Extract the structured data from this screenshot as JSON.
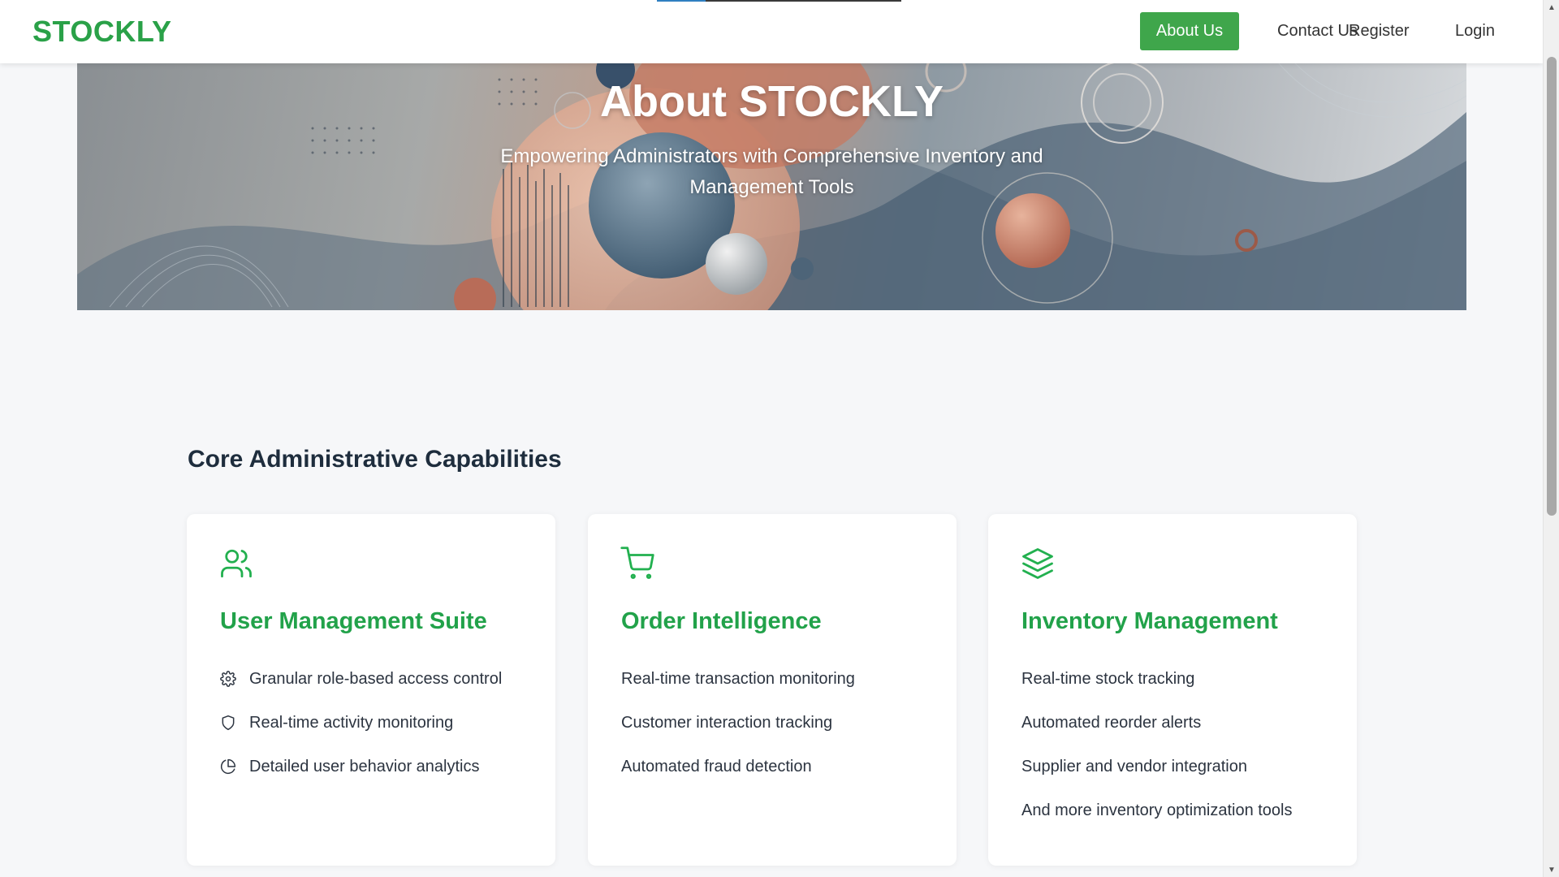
{
  "brand": "STOCKLY",
  "nav": {
    "about": "About Us",
    "contact": "Contact Us",
    "register": "Register",
    "login": "Login"
  },
  "top_progress": 0.2,
  "hero": {
    "title": "About STOCKLY",
    "subtitle": "Empowering Administrators with Comprehensive Inventory and Management Tools"
  },
  "capabilities": {
    "title": "Core Administrative Capabilities",
    "cards": [
      {
        "icon": "users-icon",
        "title": "User Management Suite",
        "items": [
          {
            "icon": "gear-icon",
            "text": "Granular role-based access control"
          },
          {
            "icon": "shield-icon",
            "text": "Real-time activity monitoring"
          },
          {
            "icon": "pie-chart-icon",
            "text": "Detailed user behavior analytics"
          }
        ]
      },
      {
        "icon": "shopping-cart-icon",
        "title": "Order Intelligence",
        "items": [
          {
            "text": "Real-time transaction monitoring"
          },
          {
            "text": "Customer interaction tracking"
          },
          {
            "text": "Automated fraud detection"
          }
        ]
      },
      {
        "icon": "layers-icon",
        "title": "Inventory Management",
        "items": [
          {
            "text": "Real-time stock tracking"
          },
          {
            "text": "Automated reorder alerts"
          },
          {
            "text": "Supplier and vendor integration"
          },
          {
            "text": "And more inventory optimization tools"
          }
        ]
      }
    ]
  },
  "colors": {
    "brand_green": "#2aa148",
    "button_green": "#3fa64b",
    "heading_dark": "#1e2d3d",
    "card_title_green": "#22a24a",
    "page_bg": "#f6f7f9"
  }
}
